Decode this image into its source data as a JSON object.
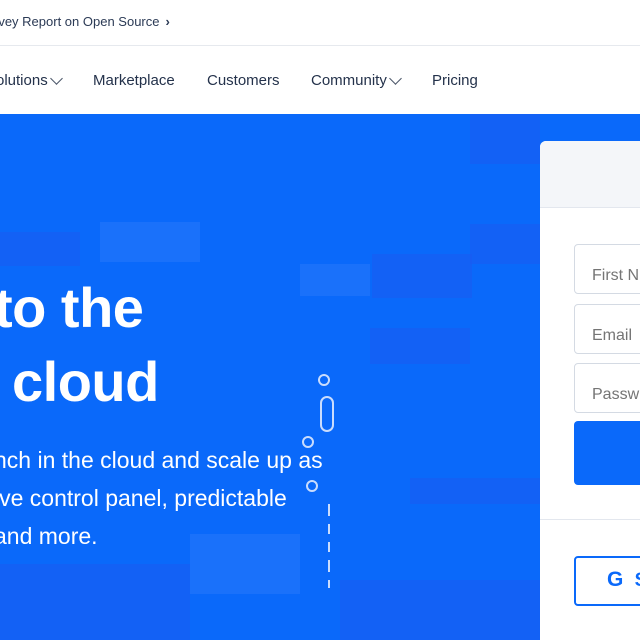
{
  "announcement": {
    "text": "rvey Report on Open Source",
    "chevron": "chevron-right-icon"
  },
  "nav": {
    "items": [
      {
        "label": "olutions",
        "has_dropdown": true
      },
      {
        "label": "Marketplace",
        "has_dropdown": false
      },
      {
        "label": "Customers",
        "has_dropdown": false
      },
      {
        "label": "Community",
        "has_dropdown": true
      },
      {
        "label": "Pricing",
        "has_dropdown": false
      }
    ]
  },
  "hero": {
    "headline_line1": "to the",
    "headline_line2": "cloud",
    "subtext_line1": "nch in the cloud and scale up as",
    "subtext_line2": "ive control panel, predictable",
    "subtext_line3": "and more."
  },
  "signup": {
    "first_name_placeholder": "First N",
    "email_placeholder": "Email",
    "password_placeholder": "Passw",
    "google_button_label": "S",
    "google_icon": "google-g-icon"
  },
  "colors": {
    "hero_bg": "#0a69fa",
    "text_dark": "#031b4e",
    "accent": "#0a69fa"
  }
}
